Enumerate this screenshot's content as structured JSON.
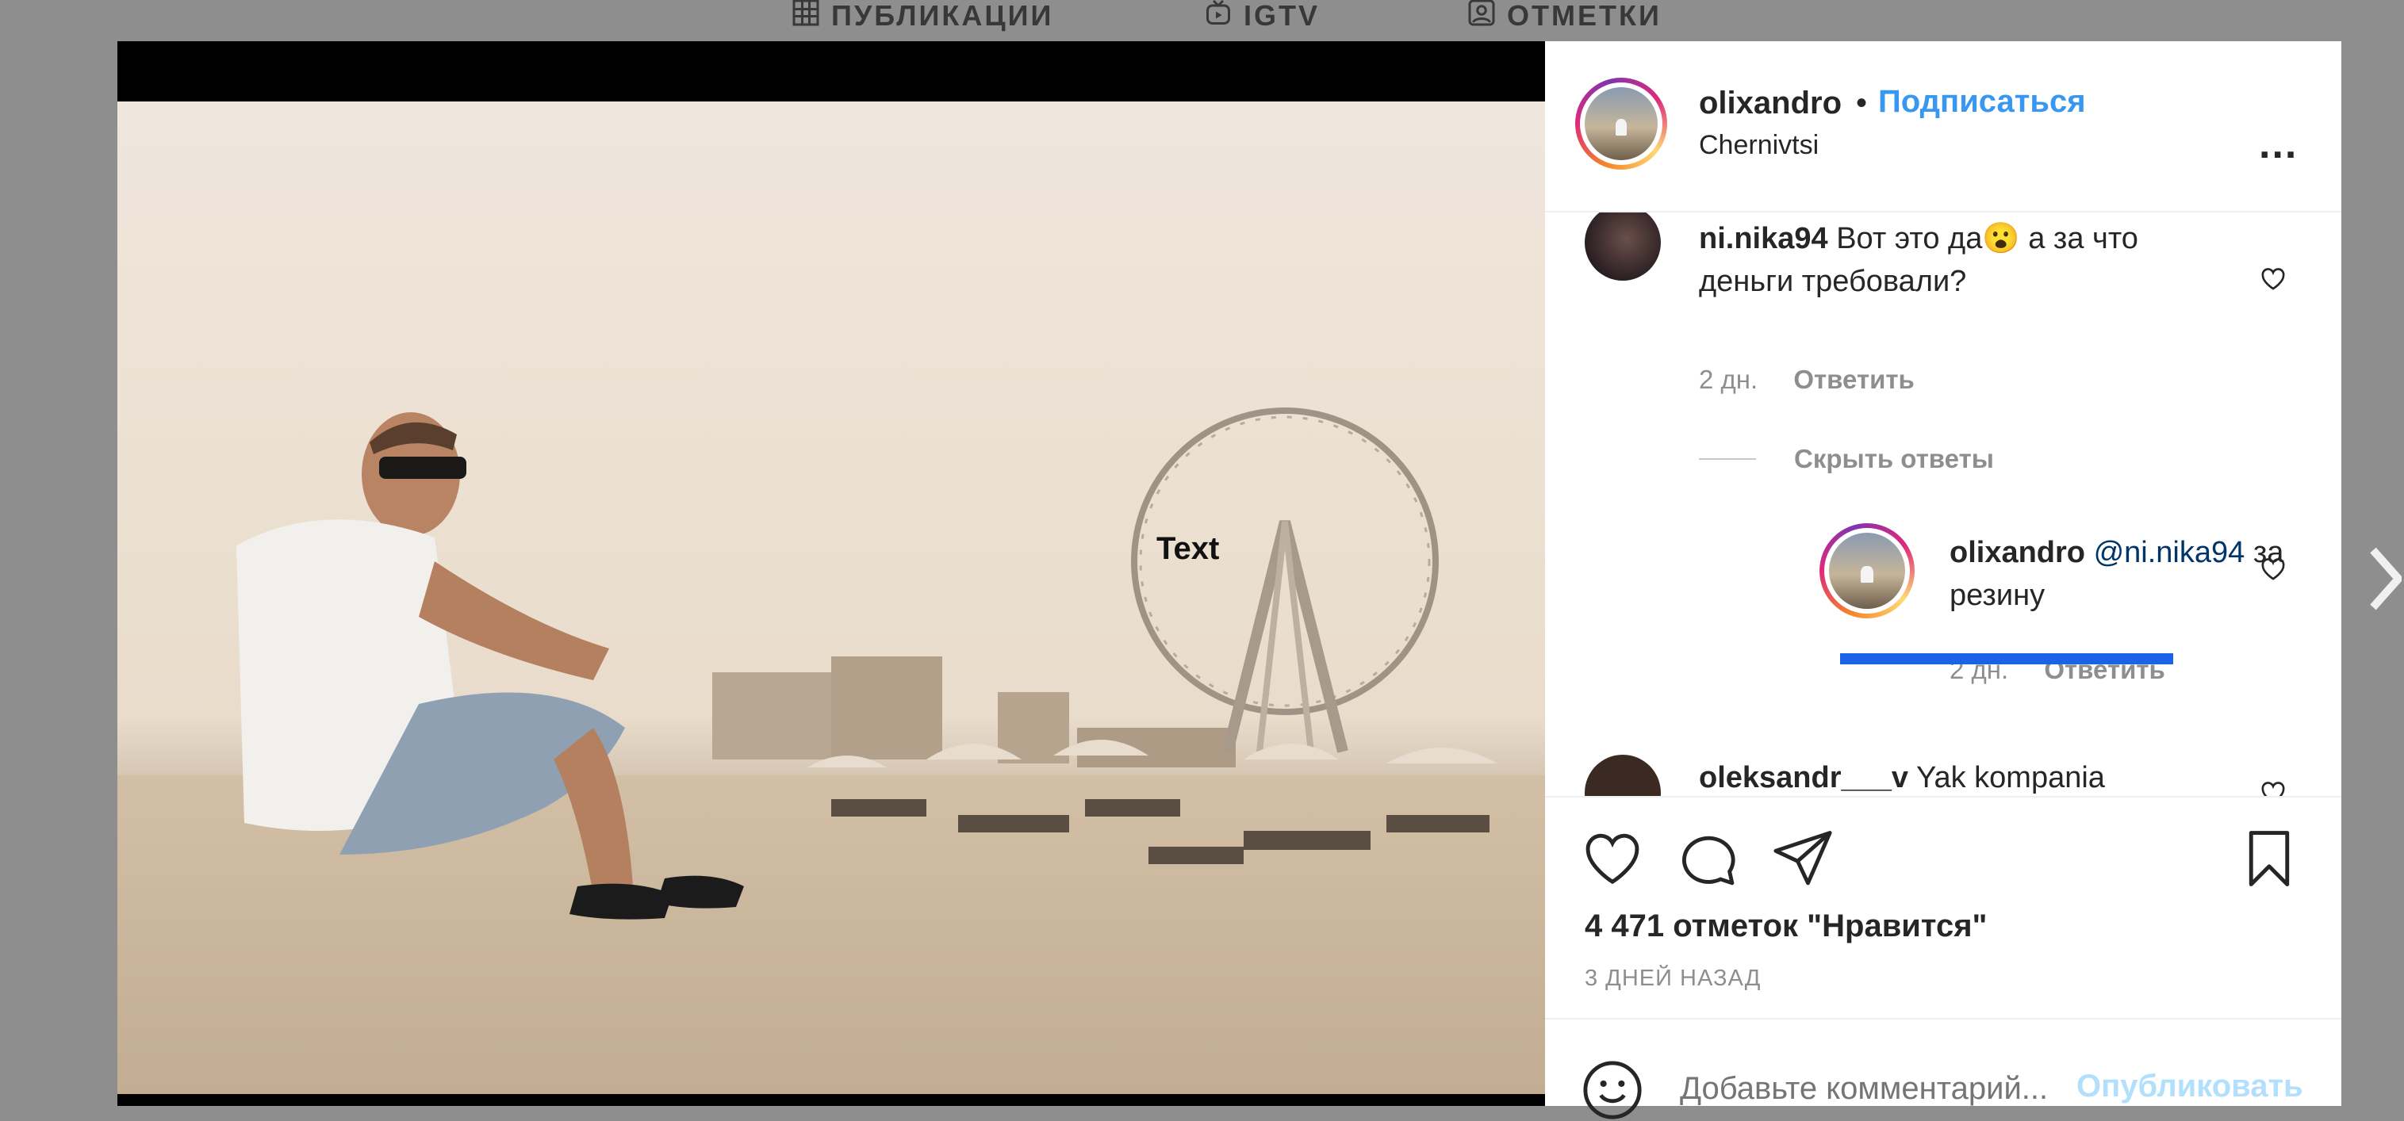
{
  "tabs": [
    {
      "label": "ПУБЛИКАЦИИ",
      "icon": "grid-icon"
    },
    {
      "label": "IGTV",
      "icon": "igtv-icon"
    },
    {
      "label": "ОТМЕТКИ",
      "icon": "tagged-icon"
    }
  ],
  "photo": {
    "overlay_text": "Text"
  },
  "header": {
    "username": "olixandro",
    "separator": "•",
    "follow_label": "Подписаться",
    "location": "Chernivtsi",
    "more_label": "..."
  },
  "comments": [
    {
      "username": "ni.nika94",
      "text": "Вот это да😮 а за что деньги требовали?",
      "time": "2 дн.",
      "reply_label": "Ответить",
      "hide_replies_label": "Скрыть ответы",
      "replies": [
        {
          "username": "olixandro",
          "mention": "@ni.nika94",
          "text": "за резину",
          "time": "2 дн.",
          "reply_label": "Ответить"
        }
      ]
    },
    {
      "username": "oleksandr___v",
      "text": "Yak kompania"
    }
  ],
  "actions": {
    "icons": [
      "heart-icon",
      "comment-icon",
      "share-icon",
      "bookmark-icon"
    ],
    "likes": "4 471 отметок \"Нравится\"",
    "date": "3 ДНЕЙ НАЗАД"
  },
  "add_comment": {
    "placeholder": "Добавьте комментарий...",
    "publish_label": "Опубликовать"
  },
  "colors": {
    "accent": "#3897f0",
    "publish_disabled": "#b2dffc",
    "highlight_bar": "#1c62e6",
    "backdrop": "#8e8e8e"
  }
}
